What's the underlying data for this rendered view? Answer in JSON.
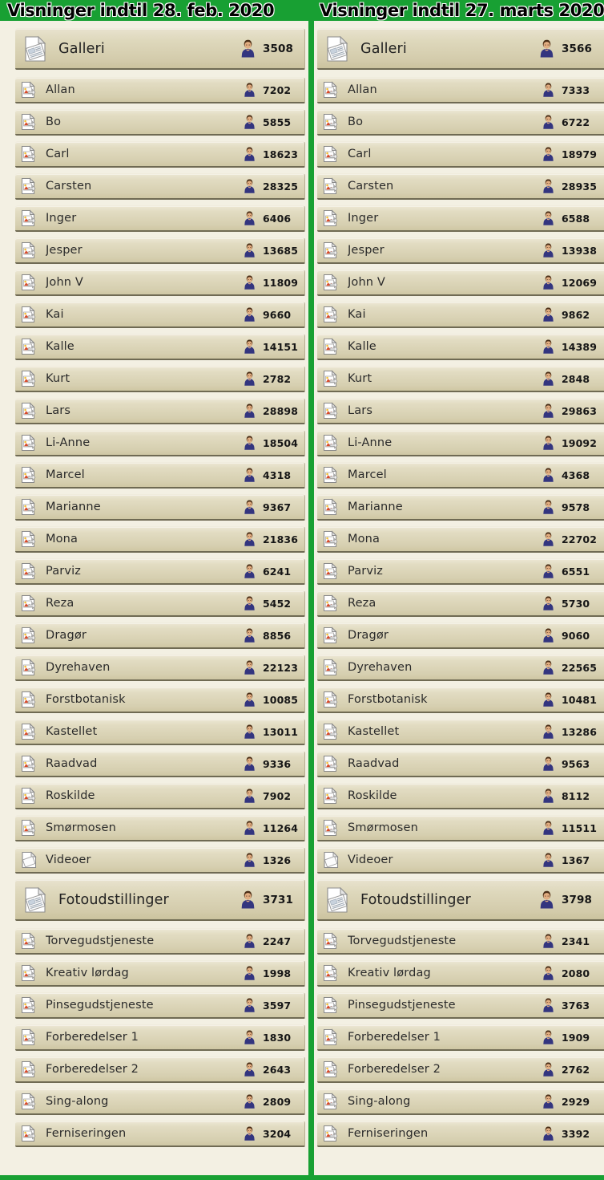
{
  "colors": {
    "accent_green": "#18a033",
    "page_background": "#f3f0e3",
    "row_light": "#ece7d4",
    "row_dark": "#cfc7a4",
    "row_border": "#6f6a53",
    "text": "#2b2b2b"
  },
  "columns": [
    {
      "header": "Visninger indtil 28. feb. 2020",
      "groups": [
        {
          "label": "Galleri",
          "count": "3508",
          "icon": "document-stack-icon",
          "avatar_icon": "person-icon",
          "items": [
            {
              "label": "Allan",
              "count": "7202",
              "icon": "image-document-icon",
              "avatar_icon": "person-icon"
            },
            {
              "label": "Bo",
              "count": "5855",
              "icon": "image-document-icon",
              "avatar_icon": "person-icon"
            },
            {
              "label": "Carl",
              "count": "18623",
              "icon": "image-document-icon",
              "avatar_icon": "person-icon"
            },
            {
              "label": "Carsten",
              "count": "28325",
              "icon": "image-document-icon",
              "avatar_icon": "person-icon"
            },
            {
              "label": "Inger",
              "count": "6406",
              "icon": "image-document-icon",
              "avatar_icon": "person-icon"
            },
            {
              "label": "Jesper",
              "count": "13685",
              "icon": "image-document-icon",
              "avatar_icon": "person-icon"
            },
            {
              "label": "John V",
              "count": "11809",
              "icon": "image-document-icon",
              "avatar_icon": "person-icon"
            },
            {
              "label": "Kai",
              "count": "9660",
              "icon": "image-document-icon",
              "avatar_icon": "person-icon"
            },
            {
              "label": "Kalle",
              "count": "14151",
              "icon": "image-document-icon",
              "avatar_icon": "person-icon"
            },
            {
              "label": "Kurt",
              "count": "2782",
              "icon": "image-document-icon",
              "avatar_icon": "person-icon"
            },
            {
              "label": "Lars",
              "count": "28898",
              "icon": "image-document-icon",
              "avatar_icon": "person-icon"
            },
            {
              "label": "Li-Anne",
              "count": "18504",
              "icon": "image-document-icon",
              "avatar_icon": "person-icon"
            },
            {
              "label": "Marcel",
              "count": "4318",
              "icon": "image-document-icon",
              "avatar_icon": "person-icon"
            },
            {
              "label": "Marianne",
              "count": "9367",
              "icon": "image-document-icon",
              "avatar_icon": "person-icon"
            },
            {
              "label": "Mona",
              "count": "21836",
              "icon": "image-document-icon",
              "avatar_icon": "person-icon"
            },
            {
              "label": "Parviz",
              "count": "6241",
              "icon": "image-document-icon",
              "avatar_icon": "person-icon"
            },
            {
              "label": "Reza",
              "count": "5452",
              "icon": "image-document-icon",
              "avatar_icon": "person-icon"
            },
            {
              "label": "Dragør",
              "count": "8856",
              "icon": "image-document-icon",
              "avatar_icon": "person-icon"
            },
            {
              "label": "Dyrehaven",
              "count": "22123",
              "icon": "image-document-icon",
              "avatar_icon": "person-icon"
            },
            {
              "label": "Forstbotanisk",
              "count": "10085",
              "icon": "image-document-icon",
              "avatar_icon": "person-icon"
            },
            {
              "label": "Kastellet",
              "count": "13011",
              "icon": "image-document-icon",
              "avatar_icon": "person-icon"
            },
            {
              "label": "Raadvad",
              "count": "9336",
              "icon": "image-document-icon",
              "avatar_icon": "person-icon"
            },
            {
              "label": "Roskilde",
              "count": "7902",
              "icon": "image-document-icon",
              "avatar_icon": "person-icon"
            },
            {
              "label": "Smørmosen",
              "count": "11264",
              "icon": "image-document-icon",
              "avatar_icon": "person-icon"
            },
            {
              "label": "Videoer",
              "count": "1326",
              "icon": "blank-document-icon",
              "avatar_icon": "person-icon"
            }
          ]
        },
        {
          "label": "Fotoudstillinger",
          "count": "3731",
          "icon": "document-stack-icon",
          "avatar_icon": "person-icon",
          "items": [
            {
              "label": "Torvegudstjeneste",
              "count": "2247",
              "icon": "image-document-icon",
              "avatar_icon": "person-icon"
            },
            {
              "label": "Kreativ lørdag",
              "count": "1998",
              "icon": "image-document-icon",
              "avatar_icon": "person-icon"
            },
            {
              "label": "Pinsegudstjeneste",
              "count": "3597",
              "icon": "image-document-icon",
              "avatar_icon": "person-icon"
            },
            {
              "label": "Forberedelser 1",
              "count": "1830",
              "icon": "image-document-icon",
              "avatar_icon": "person-icon"
            },
            {
              "label": "Forberedelser 2",
              "count": "2643",
              "icon": "image-document-icon",
              "avatar_icon": "person-icon"
            },
            {
              "label": "Sing-along",
              "count": "2809",
              "icon": "image-document-icon",
              "avatar_icon": "person-icon"
            },
            {
              "label": "Ferniseringen",
              "count": "3204",
              "icon": "image-document-icon",
              "avatar_icon": "person-icon"
            }
          ]
        }
      ]
    },
    {
      "header": "Visninger indtil 27. marts 2020",
      "groups": [
        {
          "label": "Galleri",
          "count": "3566",
          "icon": "document-stack-icon",
          "avatar_icon": "person-icon",
          "items": [
            {
              "label": "Allan",
              "count": "7333",
              "icon": "image-document-icon",
              "avatar_icon": "person-icon"
            },
            {
              "label": "Bo",
              "count": "6722",
              "icon": "image-document-icon",
              "avatar_icon": "person-icon"
            },
            {
              "label": "Carl",
              "count": "18979",
              "icon": "image-document-icon",
              "avatar_icon": "person-icon"
            },
            {
              "label": "Carsten",
              "count": "28935",
              "icon": "image-document-icon",
              "avatar_icon": "person-icon"
            },
            {
              "label": "Inger",
              "count": "6588",
              "icon": "image-document-icon",
              "avatar_icon": "person-icon"
            },
            {
              "label": "Jesper",
              "count": "13938",
              "icon": "image-document-icon",
              "avatar_icon": "person-icon"
            },
            {
              "label": "John V",
              "count": "12069",
              "icon": "image-document-icon",
              "avatar_icon": "person-icon"
            },
            {
              "label": "Kai",
              "count": "9862",
              "icon": "image-document-icon",
              "avatar_icon": "person-icon"
            },
            {
              "label": "Kalle",
              "count": "14389",
              "icon": "image-document-icon",
              "avatar_icon": "person-icon"
            },
            {
              "label": "Kurt",
              "count": "2848",
              "icon": "image-document-icon",
              "avatar_icon": "person-icon"
            },
            {
              "label": "Lars",
              "count": "29863",
              "icon": "image-document-icon",
              "avatar_icon": "person-icon"
            },
            {
              "label": "Li-Anne",
              "count": "19092",
              "icon": "image-document-icon",
              "avatar_icon": "person-icon"
            },
            {
              "label": "Marcel",
              "count": "4368",
              "icon": "image-document-icon",
              "avatar_icon": "person-icon"
            },
            {
              "label": "Marianne",
              "count": "9578",
              "icon": "image-document-icon",
              "avatar_icon": "person-icon"
            },
            {
              "label": "Mona",
              "count": "22702",
              "icon": "image-document-icon",
              "avatar_icon": "person-icon"
            },
            {
              "label": "Parviz",
              "count": "6551",
              "icon": "image-document-icon",
              "avatar_icon": "person-icon"
            },
            {
              "label": "Reza",
              "count": "5730",
              "icon": "image-document-icon",
              "avatar_icon": "person-icon"
            },
            {
              "label": "Dragør",
              "count": "9060",
              "icon": "image-document-icon",
              "avatar_icon": "person-icon"
            },
            {
              "label": "Dyrehaven",
              "count": "22565",
              "icon": "image-document-icon",
              "avatar_icon": "person-icon"
            },
            {
              "label": "Forstbotanisk",
              "count": "10481",
              "icon": "image-document-icon",
              "avatar_icon": "person-icon"
            },
            {
              "label": "Kastellet",
              "count": "13286",
              "icon": "image-document-icon",
              "avatar_icon": "person-icon"
            },
            {
              "label": "Raadvad",
              "count": "9563",
              "icon": "image-document-icon",
              "avatar_icon": "person-icon"
            },
            {
              "label": "Roskilde",
              "count": "8112",
              "icon": "image-document-icon",
              "avatar_icon": "person-icon"
            },
            {
              "label": "Smørmosen",
              "count": "11511",
              "icon": "image-document-icon",
              "avatar_icon": "person-icon"
            },
            {
              "label": "Videoer",
              "count": "1367",
              "icon": "blank-document-icon",
              "avatar_icon": "person-icon"
            }
          ]
        },
        {
          "label": "Fotoudstillinger",
          "count": "3798",
          "icon": "document-stack-icon",
          "avatar_icon": "person-icon",
          "items": [
            {
              "label": "Torvegudstjeneste",
              "count": "2341",
              "icon": "image-document-icon",
              "avatar_icon": "person-icon"
            },
            {
              "label": "Kreativ lørdag",
              "count": "2080",
              "icon": "image-document-icon",
              "avatar_icon": "person-icon"
            },
            {
              "label": "Pinsegudstjeneste",
              "count": "3763",
              "icon": "image-document-icon",
              "avatar_icon": "person-icon"
            },
            {
              "label": "Forberedelser 1",
              "count": "1909",
              "icon": "image-document-icon",
              "avatar_icon": "person-icon"
            },
            {
              "label": "Forberedelser 2",
              "count": "2762",
              "icon": "image-document-icon",
              "avatar_icon": "person-icon"
            },
            {
              "label": "Sing-along",
              "count": "2929",
              "icon": "image-document-icon",
              "avatar_icon": "person-icon"
            },
            {
              "label": "Ferniseringen",
              "count": "3392",
              "icon": "image-document-icon",
              "avatar_icon": "person-icon"
            }
          ]
        }
      ]
    }
  ]
}
